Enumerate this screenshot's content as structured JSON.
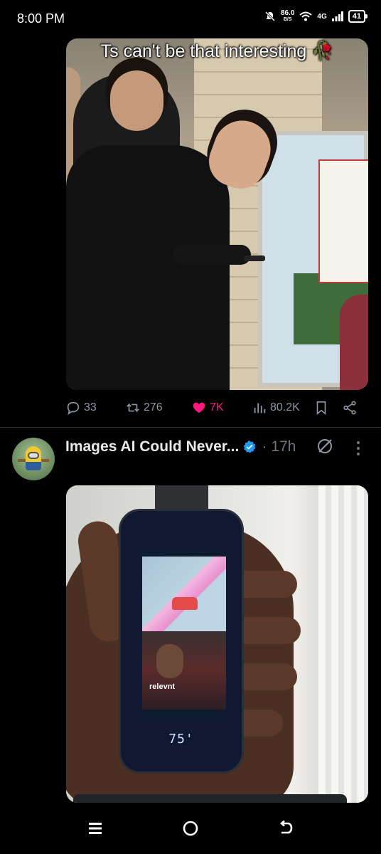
{
  "status_bar": {
    "time": "8:00 PM",
    "net_speed_value": "86.0",
    "net_speed_unit": "B/S",
    "network_type": "4G",
    "battery": "41",
    "icons": [
      "mute-notifications-icon",
      "wifi-icon",
      "signal-icon",
      "battery-icon"
    ]
  },
  "post1": {
    "caption": "Ts can't be that interesting 🥀",
    "actions": {
      "replies": "33",
      "reposts": "276",
      "likes": "7K",
      "views": "80.2K"
    },
    "icons": [
      "reply-icon",
      "repost-icon",
      "like-icon",
      "views-icon",
      "bookmark-icon",
      "share-icon"
    ],
    "like_color": "#f91880"
  },
  "post2": {
    "author_name": "Images AI Could Never...",
    "time": "17h",
    "separator": "·",
    "verified_color": "#1d9bf0",
    "icons": [
      "verified-badge-icon",
      "grok-icon",
      "more-options-icon"
    ],
    "media_overlay_text": "relevnt",
    "device_temp": "75'"
  },
  "nav_bar": {
    "icons": [
      "recent-apps-icon",
      "home-icon",
      "back-icon"
    ]
  },
  "colors": {
    "background": "#000000",
    "text_primary": "#e7e9ea",
    "text_secondary": "#71767b",
    "action_gray": "#8b98a5"
  }
}
